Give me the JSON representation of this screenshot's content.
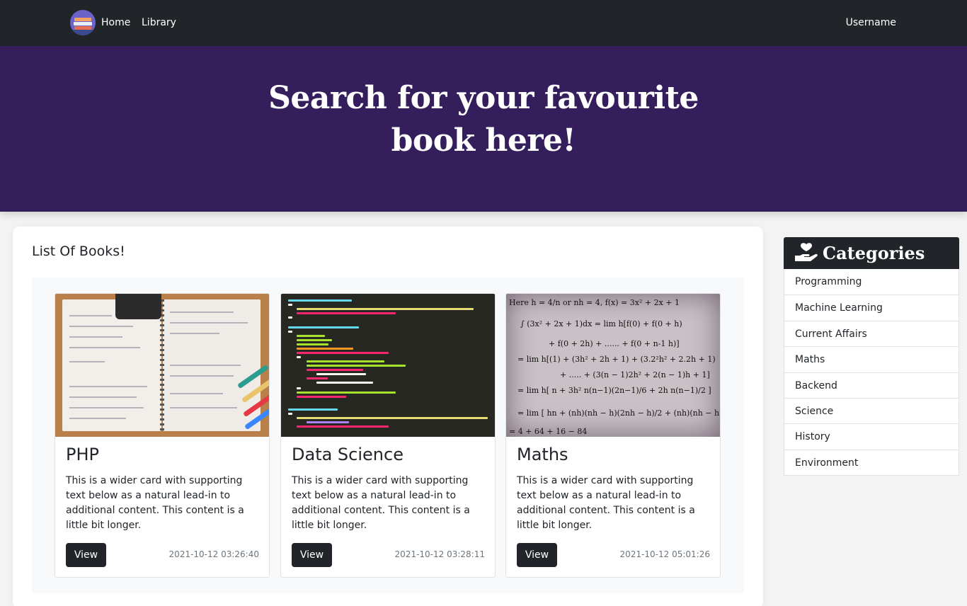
{
  "navbar": {
    "home_label": "Home",
    "library_label": "Library",
    "username_label": "Username"
  },
  "hero": {
    "title": "Search for your favourite book here!"
  },
  "main": {
    "heading": "List Of Books!",
    "cards": [
      {
        "title": "PHP",
        "text": "This is a wider card with supporting text below as a natural lead-in to additional content. This content is a little bit longer.",
        "button_label": "View",
        "date": "2021-10-12 03:26:40",
        "image_icon": "notebook-math-photo"
      },
      {
        "title": "Data Science",
        "text": "This is a wider card with supporting text below as a natural lead-in to additional content. This content is a little bit longer.",
        "button_label": "View",
        "date": "2021-10-12 03:28:11",
        "image_icon": "code-editor-photo"
      },
      {
        "title": "Maths",
        "text": "This is a wider card with supporting text below as a natural lead-in to additional content. This content is a little bit longer.",
        "button_label": "View",
        "date": "2021-10-12 05:01:26",
        "image_icon": "math-equations-photo"
      }
    ]
  },
  "sidebar": {
    "title": "Categories",
    "icon": "hand-heart-icon",
    "items": [
      "Programming",
      "Machine Learning",
      "Current Affairs",
      "Maths",
      "Backend",
      "Science",
      "History",
      "Environment"
    ]
  },
  "colors": {
    "navbar": "#212529",
    "hero": "#341f5c",
    "button": "#212529"
  }
}
